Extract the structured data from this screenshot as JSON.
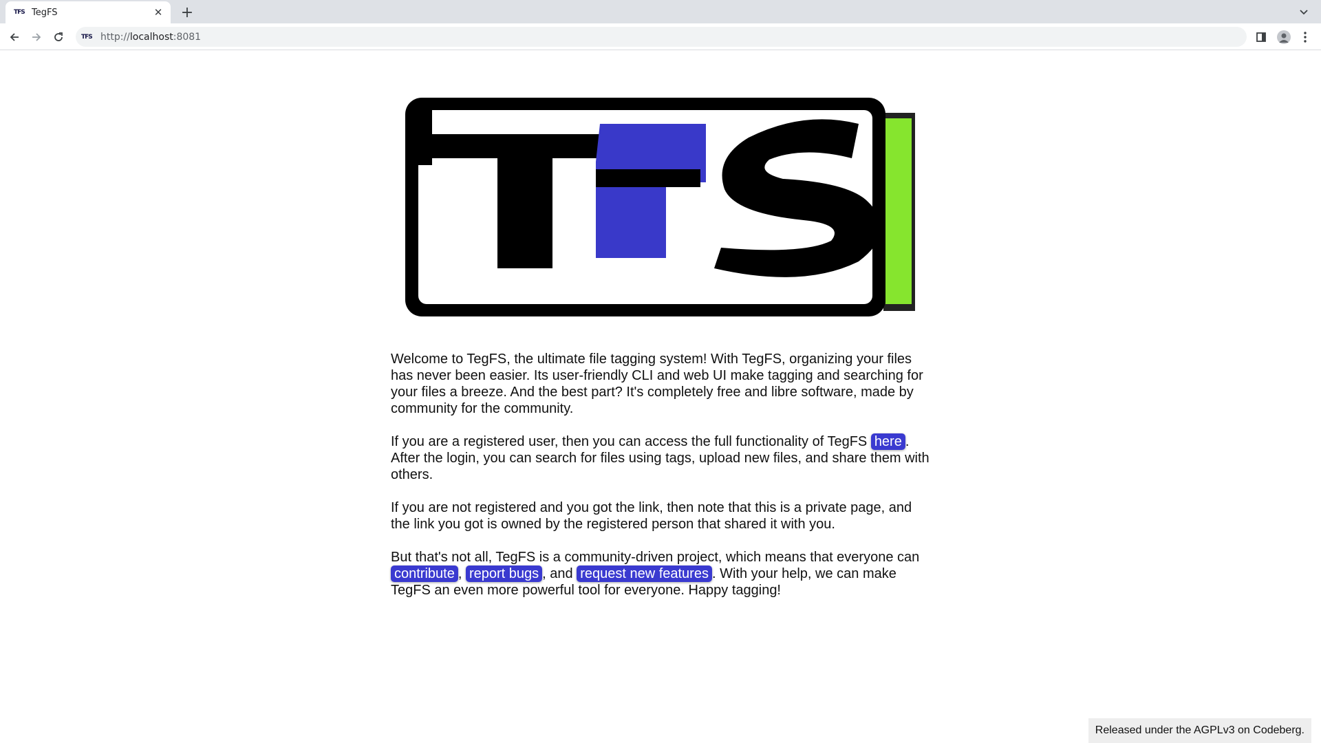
{
  "browser": {
    "tab": {
      "favicon_text": "TFS",
      "title": "TegFS",
      "close_glyph": "✕"
    },
    "new_tab_glyph": "+",
    "url": {
      "scheme": "http://",
      "host": "localhost",
      "port": ":8081"
    },
    "icons": [
      "back-arrow-icon",
      "forward-arrow-icon",
      "reload-icon",
      "site-info-icon",
      "side-panel-icon",
      "profile-icon",
      "kebab-menu-icon",
      "tab-search-dropdown-icon"
    ]
  },
  "logo": {
    "letters": "TFS",
    "colors": {
      "frame": "#000000",
      "accent_blue": "#3939c9",
      "battery_green": "#86e52e"
    }
  },
  "content": {
    "para1": "Welcome to TegFS, the ultimate file tagging system! With TegFS, organizing your files has never been easier. Its user-friendly CLI and web UI make tagging and searching for your files a breeze. And the best part? It's completely free and libre software, made by community for the community.",
    "para2_before": "If you are a registered user, then you can access the full functionality of TegFS ",
    "para2_link": "here",
    "para2_after": ". After the login, you can search for files using tags, upload new files, and share them with others.",
    "para3": "If you are not registered and you got the link, then note that this is a private page, and the link you got is owned by the registered person that shared it with you.",
    "para4_before": "But that's not all, TegFS is a community-driven project, which means that everyone can ",
    "para4_link1": "contribute",
    "para4_sep1": ", ",
    "para4_link2": "report bugs",
    "para4_sep2": ", and ",
    "para4_link3": "request new features",
    "para4_after": ". With your help, we can make TegFS an even more powerful tool for everyone. Happy tagging!"
  },
  "footer": {
    "text": "Released under the AGPLv3 on Codeberg."
  },
  "colors": {
    "link_bg": "#3a3ad0",
    "link_text": "#ffffff",
    "tabstrip_bg": "#dee1e6",
    "omnibox_bg": "#f1f3f4",
    "footer_bg": "#eeeeee"
  }
}
